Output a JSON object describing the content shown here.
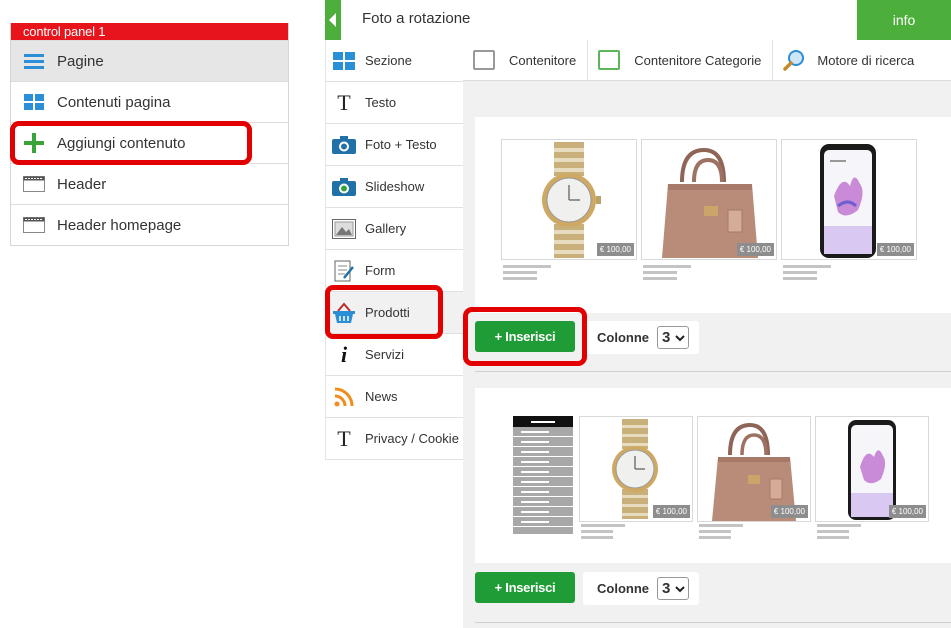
{
  "control_panel": {
    "title": "control panel 1",
    "items": [
      {
        "label": "Pagine",
        "icon": "hamburger-icon"
      },
      {
        "label": "Contenuti pagina",
        "icon": "grid-icon"
      },
      {
        "label": "Aggiungi contenuto",
        "icon": "plus-icon"
      },
      {
        "label": "Header",
        "icon": "header-icon"
      },
      {
        "label": "Header homepage",
        "icon": "header-icon"
      }
    ]
  },
  "header": {
    "title": "Foto a rotazione",
    "info_label": "info"
  },
  "sidebar": {
    "items": [
      {
        "label": "Sezione",
        "icon": "section-icon"
      },
      {
        "label": "Testo",
        "icon": "text-icon"
      },
      {
        "label": "Foto + Testo",
        "icon": "camera-icon"
      },
      {
        "label": "Slideshow",
        "icon": "slideshow-icon"
      },
      {
        "label": "Gallery",
        "icon": "gallery-icon"
      },
      {
        "label": "Form",
        "icon": "form-icon"
      },
      {
        "label": "Prodotti",
        "icon": "basket-icon"
      },
      {
        "label": "Servizi",
        "icon": "info-icon"
      },
      {
        "label": "News",
        "icon": "rss-icon"
      },
      {
        "label": "Privacy / Cookie",
        "icon": "text-icon"
      }
    ]
  },
  "tabs": [
    {
      "label": "Contenitore"
    },
    {
      "label": "Contenitore Categorie"
    },
    {
      "label": "Motore di ricerca"
    }
  ],
  "blocks": [
    {
      "prices": [
        "€ 100,00",
        "€ 100,00",
        "€ 100,00"
      ],
      "insert_label": "+ Inserisci",
      "columns_label": "Colonne",
      "columns_value": "3"
    },
    {
      "prices": [
        "€ 100,00",
        "€ 100,00",
        "€ 100,00"
      ],
      "insert_label": "+ Inserisci",
      "columns_label": "Colonne",
      "columns_value": "3"
    }
  ],
  "colors": {
    "accent_green": "#4cae3b",
    "button_green": "#1f9c35",
    "panel_red": "#e8141b",
    "highlight_red": "#e30000"
  }
}
